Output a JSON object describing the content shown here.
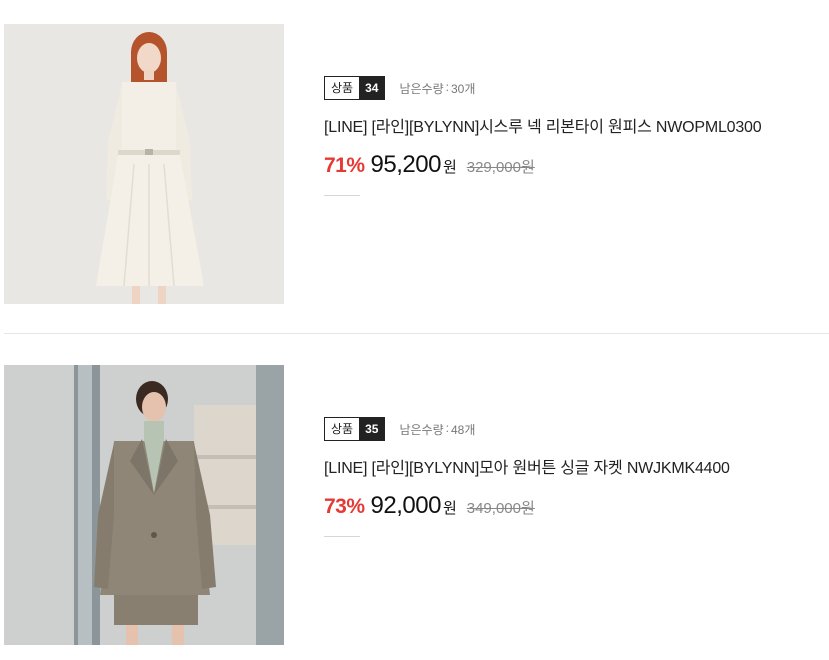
{
  "products": [
    {
      "badge_label": "상품",
      "badge_number": "34",
      "stock_label": "남은수량",
      "stock_sep": ":",
      "stock_value": "30개",
      "title": "[LINE] [라인][BYLYNN]시스루 넥 리본타이 원피스 NWOPML0300",
      "discount": "71%",
      "price": "95,200",
      "price_unit": "원",
      "original_price": "329,000원",
      "image_icon": "dress-photo"
    },
    {
      "badge_label": "상품",
      "badge_number": "35",
      "stock_label": "남은수량",
      "stock_sep": ":",
      "stock_value": "48개",
      "title": "[LINE] [라인][BYLYNN]모아 원버튼 싱글 자켓 NWJKMK4400",
      "discount": "73%",
      "price": "92,000",
      "price_unit": "원",
      "original_price": "349,000원",
      "image_icon": "jacket-photo"
    }
  ],
  "colors": {
    "discount": "#e53935",
    "badge_dark": "#222222",
    "divider": "#e6e6e6"
  }
}
